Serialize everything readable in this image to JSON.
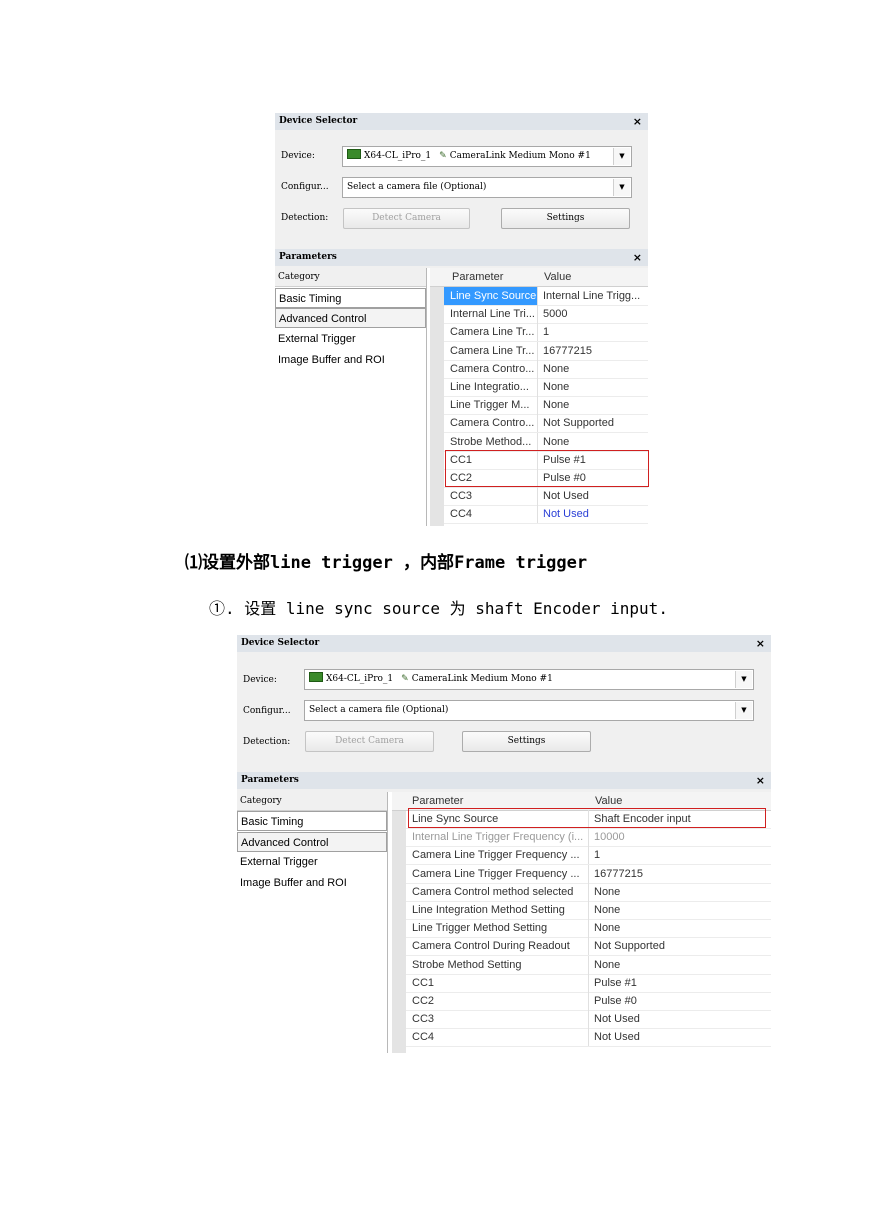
{
  "device_selector": {
    "title": "Device Selector",
    "close": "×",
    "device_label": "Device:",
    "device_name": "X64-CL_iPro_1",
    "camera_name": "CameraLink Medium Mono #1",
    "config_label": "Configur...",
    "config_value": "Select a camera file (Optional)",
    "detection_label": "Detection:",
    "detect_button": "Detect Camera",
    "settings_button": "Settings"
  },
  "parameters_panel": {
    "title": "Parameters",
    "category_header": "Category",
    "parameter_header": "Parameter",
    "value_header": "Value",
    "categories": [
      "Basic Timing",
      "Advanced Control",
      "External Trigger",
      "Image Buffer and ROI"
    ]
  },
  "screenshot1_rows": [
    {
      "name": "Line Sync Source",
      "value": "Internal Line Trigg..."
    },
    {
      "name": "Internal Line Tri...",
      "value": "5000"
    },
    {
      "name": "Camera Line Tr...",
      "value": "1"
    },
    {
      "name": "Camera Line Tr...",
      "value": "16777215"
    },
    {
      "name": "Camera Contro...",
      "value": "None"
    },
    {
      "name": "Line Integratio...",
      "value": "None"
    },
    {
      "name": "Line Trigger M...",
      "value": "None"
    },
    {
      "name": "Camera Contro...",
      "value": "Not Supported"
    },
    {
      "name": "Strobe Method...",
      "value": "None"
    },
    {
      "name": "CC1",
      "value": "Pulse #1"
    },
    {
      "name": "CC2",
      "value": "Pulse #0"
    },
    {
      "name": "CC3",
      "value": "Not Used"
    },
    {
      "name": "CC4",
      "value": "Not Used"
    }
  ],
  "heading": {
    "prefix": "⑴设置外部",
    "part1": "line trigger ，",
    "middle": "内部",
    "part2": "Frame trigger"
  },
  "step": {
    "text": "①. 设置 line sync source 为 shaft Encoder input."
  },
  "screenshot2_rows": [
    {
      "name": "Line Sync Source",
      "value": "Shaft Encoder input"
    },
    {
      "name": "Internal Line Trigger Frequency (i...",
      "value": "10000"
    },
    {
      "name": "Camera Line Trigger Frequency ...",
      "value": "1"
    },
    {
      "name": "Camera Line Trigger Frequency ...",
      "value": "16777215"
    },
    {
      "name": "Camera Control method selected",
      "value": "None"
    },
    {
      "name": "Line Integration Method Setting",
      "value": "None"
    },
    {
      "name": "Line Trigger Method Setting",
      "value": "None"
    },
    {
      "name": "Camera Control During Readout",
      "value": "Not Supported"
    },
    {
      "name": "Strobe Method Setting",
      "value": "None"
    },
    {
      "name": "CC1",
      "value": "Pulse #1"
    },
    {
      "name": "CC2",
      "value": "Pulse #0"
    },
    {
      "name": "CC3",
      "value": "Not Used"
    },
    {
      "name": "CC4",
      "value": "Not Used"
    }
  ]
}
